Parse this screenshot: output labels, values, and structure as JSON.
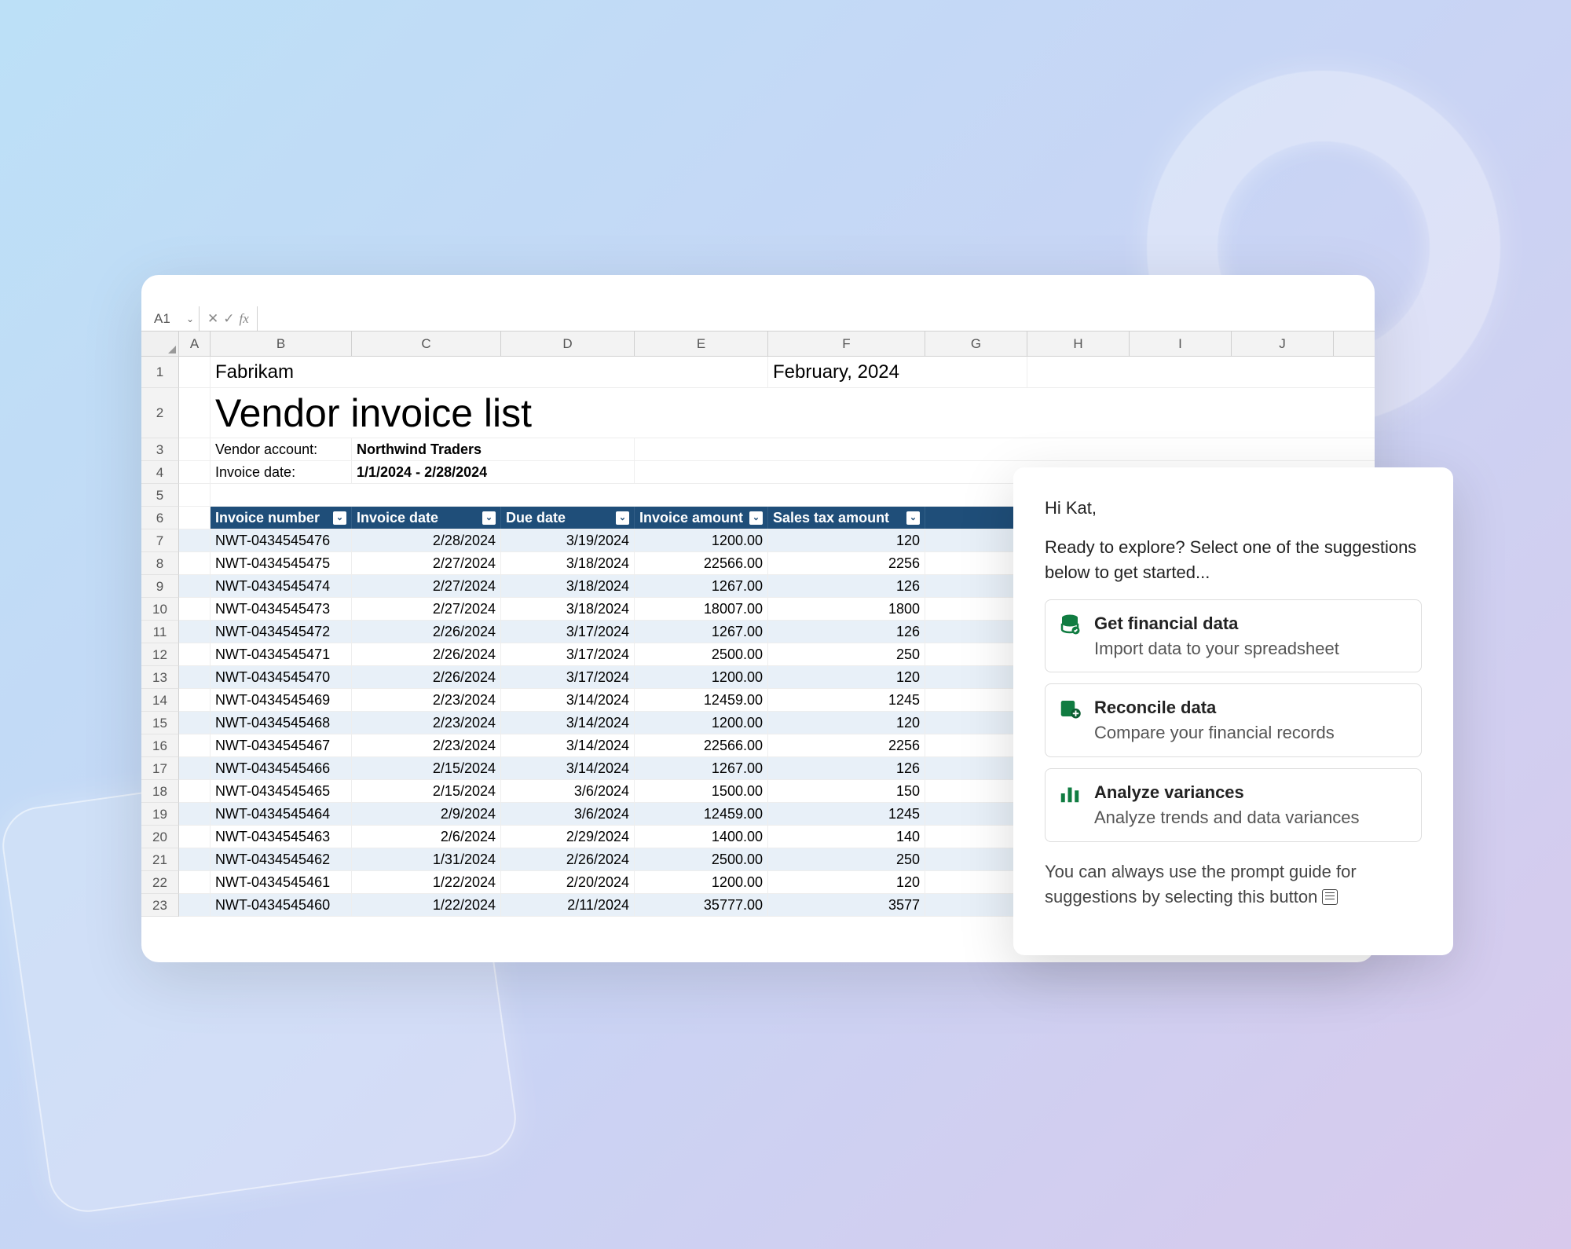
{
  "formula_bar": {
    "cell_ref": "A1",
    "fx_label": "fx"
  },
  "columns": [
    "A",
    "B",
    "C",
    "D",
    "E",
    "F",
    "G",
    "H",
    "I",
    "J"
  ],
  "rows_header_count": 23,
  "sheet": {
    "company": "Fabrikam",
    "period": "February, 2024",
    "title": "Vendor invoice list",
    "meta": [
      {
        "label": "Vendor account:",
        "value": "Northwind Traders"
      },
      {
        "label": "Invoice date:",
        "value": "1/1/2024 - 2/28/2024"
      }
    ],
    "headers": [
      "Invoice number",
      "Invoice date",
      "Due date",
      "Invoice amount",
      "Sales tax amount"
    ],
    "data": [
      [
        "NWT-0434545476",
        "2/28/2024",
        "3/19/2024",
        "1200.00",
        "120"
      ],
      [
        "NWT-0434545475",
        "2/27/2024",
        "3/18/2024",
        "22566.00",
        "2256"
      ],
      [
        "NWT-0434545474",
        "2/27/2024",
        "3/18/2024",
        "1267.00",
        "126"
      ],
      [
        "NWT-0434545473",
        "2/27/2024",
        "3/18/2024",
        "18007.00",
        "1800"
      ],
      [
        "NWT-0434545472",
        "2/26/2024",
        "3/17/2024",
        "1267.00",
        "126"
      ],
      [
        "NWT-0434545471",
        "2/26/2024",
        "3/17/2024",
        "2500.00",
        "250"
      ],
      [
        "NWT-0434545470",
        "2/26/2024",
        "3/17/2024",
        "1200.00",
        "120"
      ],
      [
        "NWT-0434545469",
        "2/23/2024",
        "3/14/2024",
        "12459.00",
        "1245"
      ],
      [
        "NWT-0434545468",
        "2/23/2024",
        "3/14/2024",
        "1200.00",
        "120"
      ],
      [
        "NWT-0434545467",
        "2/23/2024",
        "3/14/2024",
        "22566.00",
        "2256"
      ],
      [
        "NWT-0434545466",
        "2/15/2024",
        "3/14/2024",
        "1267.00",
        "126"
      ],
      [
        "NWT-0434545465",
        "2/15/2024",
        "3/6/2024",
        "1500.00",
        "150"
      ],
      [
        "NWT-0434545464",
        "2/9/2024",
        "3/6/2024",
        "12459.00",
        "1245"
      ],
      [
        "NWT-0434545463",
        "2/6/2024",
        "2/29/2024",
        "1400.00",
        "140"
      ],
      [
        "NWT-0434545462",
        "1/31/2024",
        "2/26/2024",
        "2500.00",
        "250"
      ],
      [
        "NWT-0434545461",
        "1/22/2024",
        "2/20/2024",
        "1200.00",
        "120"
      ],
      [
        "NWT-0434545460",
        "1/22/2024",
        "2/11/2024",
        "35777.00",
        "3577"
      ]
    ]
  },
  "copilot": {
    "greeting": "Hi Kat,",
    "intro": "Ready to explore? Select one of the suggestions below to get started...",
    "suggestions": [
      {
        "title": "Get financial data",
        "desc": "Import data to your spreadsheet",
        "icon": "database-icon",
        "color": "#107c41"
      },
      {
        "title": "Reconcile data",
        "desc": "Compare your financial records",
        "icon": "reconcile-icon",
        "color": "#107c41"
      },
      {
        "title": "Analyze variances",
        "desc": "Analyze trends and data variances",
        "icon": "chart-bar-icon",
        "color": "#107c41"
      }
    ],
    "footer": "You can always use the prompt guide for suggestions by selecting this button"
  }
}
